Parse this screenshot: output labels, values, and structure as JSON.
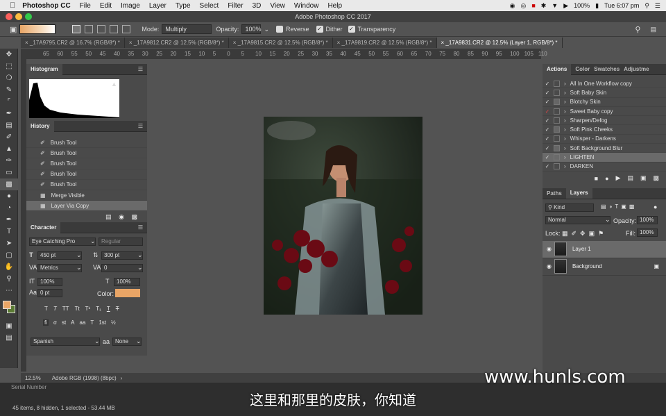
{
  "menubar": {
    "app": "Photoshop CC",
    "items": [
      "File",
      "Edit",
      "Image",
      "Layer",
      "Type",
      "Select",
      "Filter",
      "3D",
      "View",
      "Window",
      "Help"
    ],
    "battery": "100%",
    "time": "Tue 6:07 pm"
  },
  "window": {
    "title": "Adobe Photoshop CC 2017"
  },
  "options": {
    "mode_label": "Mode:",
    "mode": "Multiply",
    "opacity_label": "Opacity:",
    "opacity": "100%",
    "reverse": "Reverse",
    "dither": "Dither",
    "transparency": "Transparency"
  },
  "tabs": [
    "_17A9795.CR2 @ 16.7% (RGB/8*) *",
    "_17A9812.CR2 @ 12.5% (RGB/8*) *",
    "_17A9815.CR2 @ 12.5% (RGB/8*) *",
    "_17A9819.CR2 @ 12.5% (RGB/8*) *",
    "_17A9831.CR2 @ 12.5% (Layer 1, RGB/8*) *"
  ],
  "ruler": [
    "65",
    "60",
    "55",
    "50",
    "45",
    "40",
    "35",
    "30",
    "25",
    "20",
    "15",
    "10",
    "5",
    "0",
    "5",
    "10",
    "15",
    "20",
    "25",
    "30",
    "35",
    "40",
    "45",
    "50",
    "55",
    "60",
    "65",
    "70",
    "75",
    "80",
    "85",
    "90",
    "95",
    "100",
    "105",
    "110"
  ],
  "histogram": {
    "title": "Histogram"
  },
  "history": {
    "title": "History",
    "items": [
      "Brush Tool",
      "Brush Tool",
      "Brush Tool",
      "Brush Tool",
      "Brush Tool",
      "Merge Visible",
      "Layer Via Copy"
    ]
  },
  "character": {
    "title": "Character",
    "font": "Eye Catching Pro",
    "style": "Regular",
    "size": "450 pt",
    "leading": "300 pt",
    "kerning": "Metrics",
    "tracking": "0",
    "vscale": "100%",
    "hscale": "100%",
    "baseline": "0 pt",
    "color_label": "Color:",
    "language": "Spanish",
    "aa_label": "aa",
    "aa": "None",
    "color": "#e9a566"
  },
  "actions": {
    "tabs": [
      "Actions",
      "Color",
      "Swatches",
      "Adjustme"
    ],
    "items": [
      "All In One Workflow copy",
      "Soft Baby Skin",
      "Blotchy Skin",
      "Sweet Baby copy",
      "Sharpen/Defog",
      "Soft Pink Cheeks",
      "Whisper - Darkens",
      "Soft Background Blur",
      "LIGHTEN",
      "DARKEN"
    ]
  },
  "layers": {
    "tabs": [
      "Paths",
      "Layers"
    ],
    "kind": "Kind",
    "blend": "Normal",
    "opacity_label": "Opacity:",
    "opacity": "100%",
    "lock_label": "Lock:",
    "fill_label": "Fill:",
    "fill": "100%",
    "items": [
      "Layer 1",
      "Background"
    ]
  },
  "statusbar": {
    "zoom": "12.5%",
    "profile": "Adobe RGB (1998) (8bpc)"
  },
  "footer": "45 items, 8 hidden, 1 selected - 53.44 MB",
  "serial": "Serial Number",
  "subtitle": "这里和那里的皮肤，你知道",
  "watermark": "www.hunls.com"
}
